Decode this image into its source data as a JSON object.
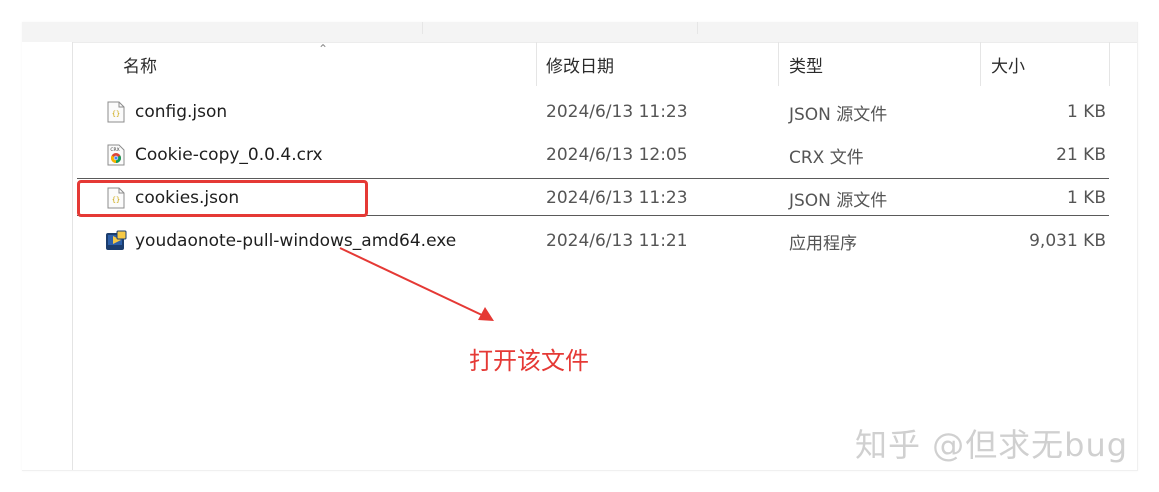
{
  "columns": {
    "name": "名称",
    "modified": "修改日期",
    "type": "类型",
    "size": "大小"
  },
  "files": [
    {
      "name": "config.json",
      "modified": "2024/6/13 11:23",
      "type": "JSON 源文件",
      "size": "1 KB",
      "icon": "json-file-icon"
    },
    {
      "name": "Cookie-copy_0.0.4.crx",
      "modified": "2024/6/13 12:05",
      "type": "CRX 文件",
      "size": "21 KB",
      "icon": "crx-file-icon"
    },
    {
      "name": "cookies.json",
      "modified": "2024/6/13 11:23",
      "type": "JSON 源文件",
      "size": "1 KB",
      "icon": "json-file-icon",
      "selected": true
    },
    {
      "name": "youdaonote-pull-windows_amd64.exe",
      "modified": "2024/6/13 11:21",
      "type": "应用程序",
      "size": "9,031 KB",
      "icon": "exe-file-icon"
    }
  ],
  "annotation": {
    "text": "打开该文件",
    "color": "#e53935"
  },
  "watermark": {
    "text": "知乎 @但求无bug"
  }
}
